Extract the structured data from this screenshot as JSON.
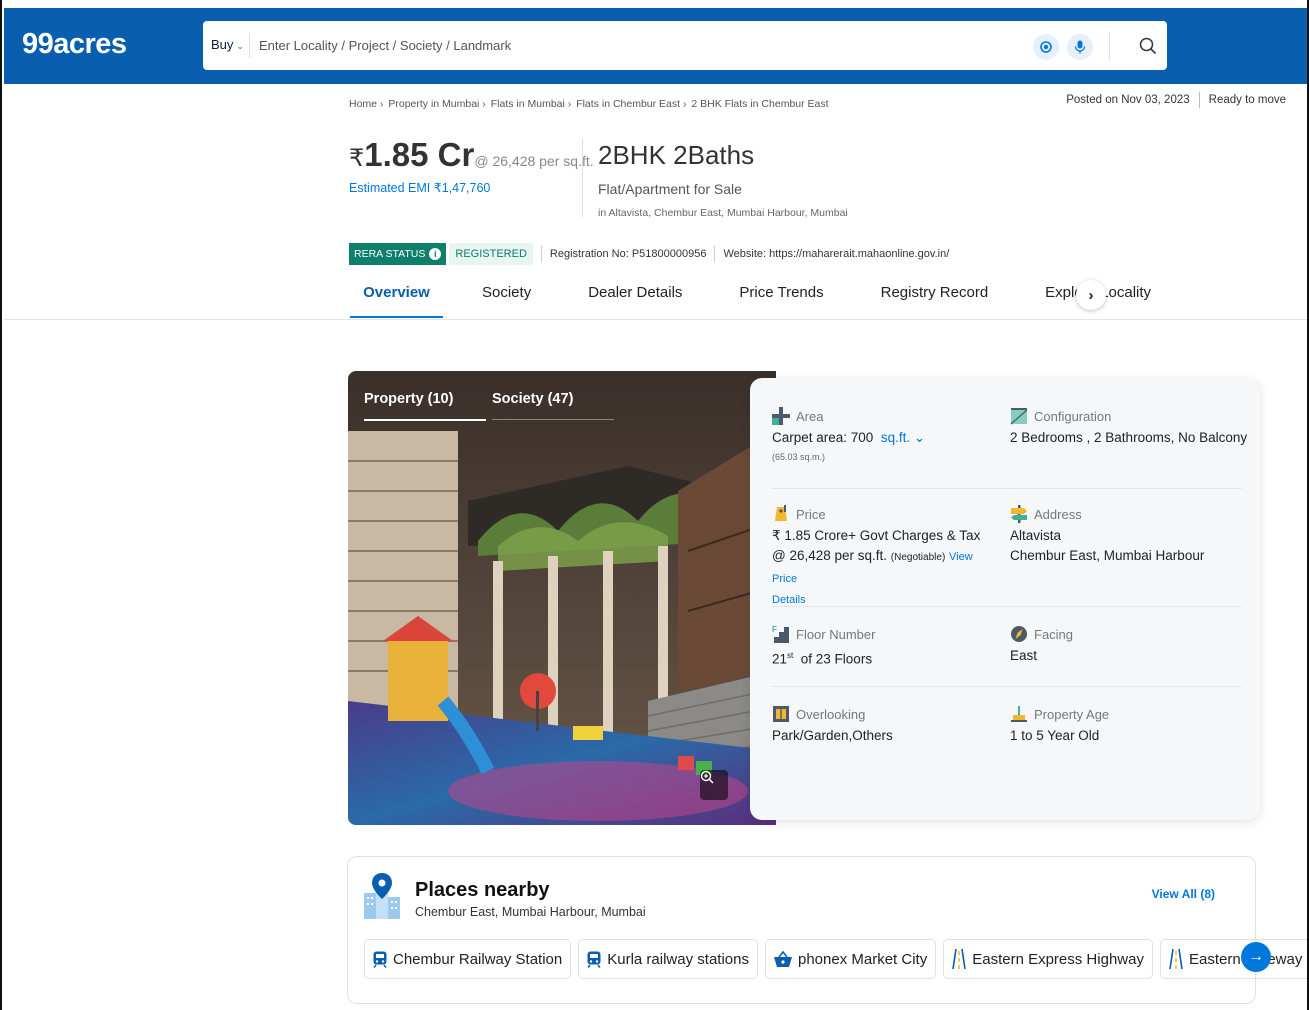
{
  "header": {
    "logo": "99acres",
    "buy_label": "Buy",
    "search_placeholder": "Enter Locality / Project / Society / Landmark"
  },
  "breadcrumb": [
    "Home ›",
    "Property in Mumbai ›",
    "Flats in Mumbai ›",
    "Flats in Chembur East ›",
    "2 BHK Flats in Chembur East"
  ],
  "posted": {
    "date": "Posted on Nov 03, 2023",
    "status": "Ready to move"
  },
  "listing": {
    "rupee": "₹",
    "price": "1.85 Cr",
    "per_sqft": "@ 26,428 per sq.ft.",
    "emi": "Estimated EMI ₹1,47,760",
    "config": "2BHK 2Baths",
    "type": "Flat/Apartment for Sale",
    "location": "in Altavista, Chembur East, Mumbai Harbour, Mumbai"
  },
  "rera": {
    "label": "RERA STATUS",
    "info": "i",
    "status": "REGISTERED",
    "reg_no": "Registration No: P51800000956",
    "website": "Website: https://maharerait.mahaonline.gov.in/"
  },
  "tabs": [
    {
      "label": "Overview",
      "active": true
    },
    {
      "label": "Society",
      "active": false
    },
    {
      "label": "Dealer Details",
      "active": false
    },
    {
      "label": "Price Trends",
      "active": false
    },
    {
      "label": "Registry Record",
      "active": false
    },
    {
      "label": "Explore Locality",
      "active": false
    }
  ],
  "tab_next": "›",
  "photo": {
    "tab1": "Property (10)",
    "tab2": "Society (47)"
  },
  "details": {
    "area": {
      "label": "Area",
      "value": "Carpet area: 700",
      "unit": "sq.ft.",
      "sub": "(65.03 sq.m.)"
    },
    "configuration": {
      "label": "Configuration",
      "value": "2 Bedrooms , 2 Bathrooms, No Balcony"
    },
    "price": {
      "label": "Price",
      "line1": "₹ 1.85 Crore+ Govt Charges & Tax",
      "line2": "@ 26,428 per sq.ft.",
      "negotiable": "(Negotiable)",
      "link1": "View Price",
      "link2": "Details"
    },
    "address": {
      "label": "Address",
      "line1": "Altavista",
      "line2": "Chembur East, Mumbai Harbour"
    },
    "floor": {
      "label": "Floor Number",
      "num": "21",
      "sup": "st",
      "rest": "of 23 Floors"
    },
    "facing": {
      "label": "Facing",
      "value": "East"
    },
    "overlooking": {
      "label": "Overlooking",
      "value": "Park/Garden,Others"
    },
    "age": {
      "label": "Property Age",
      "value": "1 to 5 Year Old"
    }
  },
  "places": {
    "title": "Places nearby",
    "subtitle": "Chembur East, Mumbai Harbour, Mumbai",
    "view_all": "View All (8)",
    "items": [
      {
        "label": "Chembur Railway Station",
        "icon": "train-icon"
      },
      {
        "label": "Kurla railway stations",
        "icon": "train-icon"
      },
      {
        "label": "phonex Market City",
        "icon": "shopping-basket-icon"
      },
      {
        "label": "Eastern Express Highway",
        "icon": "road-icon"
      },
      {
        "label": "Eastern Freeway",
        "icon": "road-icon"
      }
    ],
    "next": "→"
  },
  "colors": {
    "brand_blue": "#0a5eb0",
    "link_blue": "#0078db",
    "rera_green": "#0d7f6b"
  }
}
